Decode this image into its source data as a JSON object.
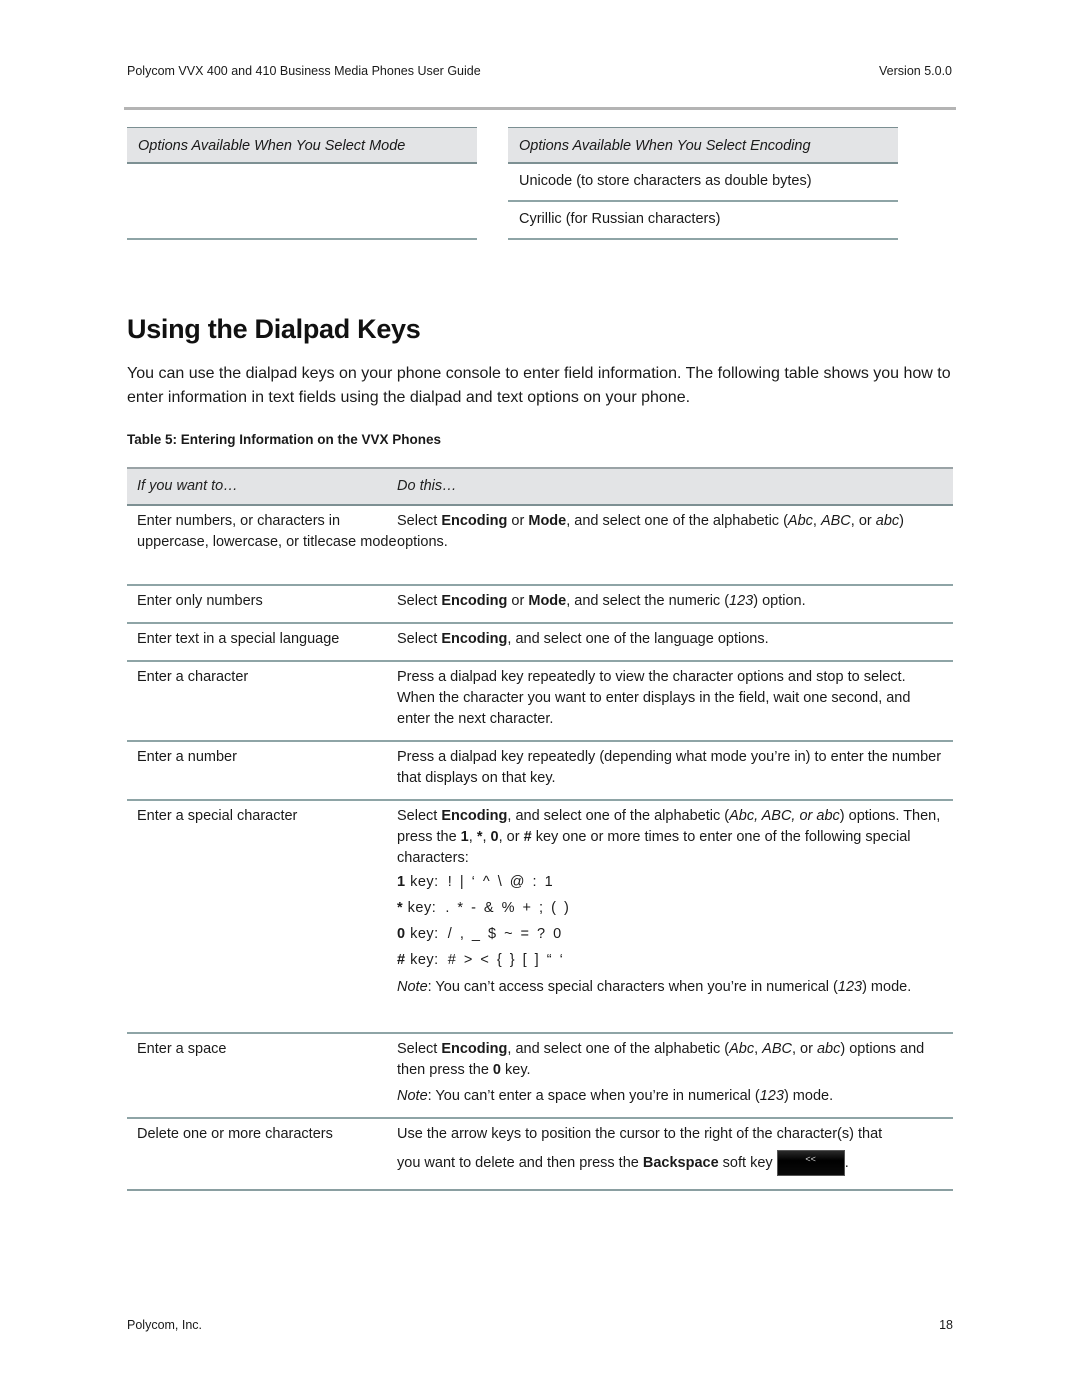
{
  "header": {
    "title": "Polycom VVX 400 and 410 Business Media Phones User Guide",
    "version": "Version 5.0.0"
  },
  "options_tables": {
    "mode": {
      "heading": "Options Available When You Select Mode",
      "rows": []
    },
    "encoding": {
      "heading": "Options Available When You Select Encoding",
      "rows": [
        "Unicode (to store characters as double bytes)",
        "Cyrillic (for Russian characters)"
      ]
    }
  },
  "section": {
    "title": "Using the Dialpad Keys",
    "intro": "You can use the dialpad keys on your phone console to enter field information. The following table shows you how to enter information in text fields using the dialpad and text options on your phone."
  },
  "table": {
    "caption": "Table 5: Entering Information on the VVX Phones",
    "col1": "If you want to…",
    "col2": "Do this…",
    "rows": [
      {
        "want": "Enter numbers, or characters in uppercase, lowercase, or titlecase mode"
      },
      {
        "want": "Enter only numbers"
      },
      {
        "want": "Enter text in a special language"
      },
      {
        "want": "Enter a character",
        "do": "Press a dialpad key repeatedly to view the character options and stop to select. When the character you want to enter displays in the field, wait one second, and enter the next character."
      },
      {
        "want": "Enter a number",
        "do": "Press a dialpad key repeatedly (depending what mode you’re in) to enter the number that displays on that key."
      },
      {
        "want": "Enter a special character",
        "keys": [
          {
            "key": "1",
            "label": " key:",
            "chars": "! | ‘ ^ \\ @ : 1"
          },
          {
            "key": "*",
            "label": " key:",
            "chars": ". * - & % + ; ( )"
          },
          {
            "key": "0",
            "label": " key:",
            "chars": "/ , _ $ ~ = ? 0"
          },
          {
            "key": "#",
            "label": " key:",
            "chars": "# > < { } [ ] “ ‘"
          }
        ]
      },
      {
        "want": "Enter a space"
      },
      {
        "want": "Delete one or more characters",
        "softkey_glyph": "<<"
      }
    ]
  },
  "footer": {
    "company": "Polycom, Inc.",
    "page": "18"
  }
}
